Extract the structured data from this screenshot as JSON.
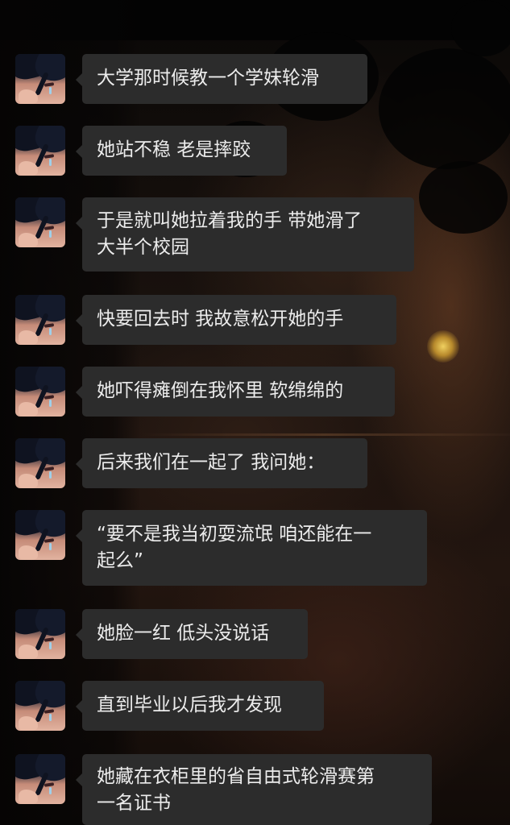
{
  "chat": {
    "messages": [
      {
        "text": "大学那时候教一个学妹轮滑",
        "avatar": "crying-anime-avatar"
      },
      {
        "text": "她站不稳 老是摔跤",
        "avatar": "crying-anime-avatar"
      },
      {
        "text": "于是就叫她拉着我的手 带她滑了\n大半个校园",
        "avatar": "crying-anime-avatar"
      },
      {
        "text": "快要回去时 我故意松开她的手",
        "avatar": "crying-anime-avatar"
      },
      {
        "text": "她吓得瘫倒在我怀里 软绵绵的",
        "avatar": "crying-anime-avatar"
      },
      {
        "text": "后来我们在一起了 我问她：",
        "avatar": "crying-anime-avatar"
      },
      {
        "text": "“要不是我当初耍流氓 咱还能在一\n起么”",
        "avatar": "crying-anime-avatar"
      },
      {
        "text": "她脸一红 低头没说话",
        "avatar": "crying-anime-avatar"
      },
      {
        "text": "直到毕业以后我才发现",
        "avatar": "crying-anime-avatar"
      },
      {
        "text": "她藏在衣柜里的省自由式轮滑赛第\n一名证书",
        "avatar": "crying-anime-avatar"
      }
    ]
  },
  "colors": {
    "bubble": "#2c2c2c",
    "text": "#ececec",
    "background": "#0b0908"
  }
}
